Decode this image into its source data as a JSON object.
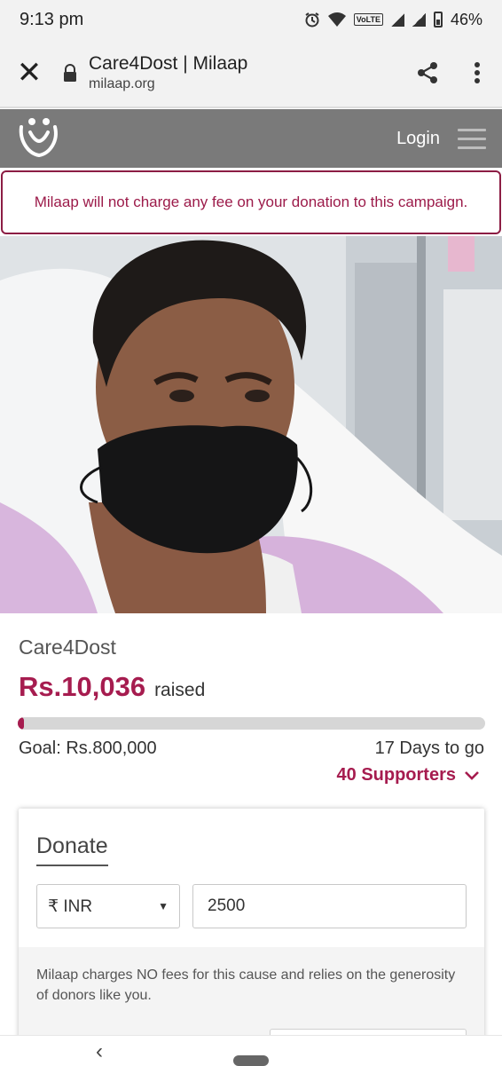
{
  "status": {
    "time": "9:13 pm",
    "volte": "VoLTE",
    "battery": "46%"
  },
  "browser": {
    "title": "Care4Dost | Milaap",
    "domain": "milaap.org"
  },
  "header": {
    "login": "Login"
  },
  "notice": "Milaap will not charge any fee on your donation to this campaign.",
  "campaign": {
    "name": "Care4Dost",
    "raised_amount": "Rs.10,036",
    "raised_label": "raised",
    "progress_fraction": 0.0125,
    "goal": "Goal: Rs.800,000",
    "days_left": "17 Days to go",
    "supporters": "40 Supporters"
  },
  "donate": {
    "title": "Donate",
    "currency": "₹ INR",
    "amount": "2500",
    "fee_note": "Milaap charges NO fees for this cause and relies on the generosity of donors like you."
  },
  "colors": {
    "brand": "#a61c4f",
    "header_bg": "#7a7a7a"
  }
}
